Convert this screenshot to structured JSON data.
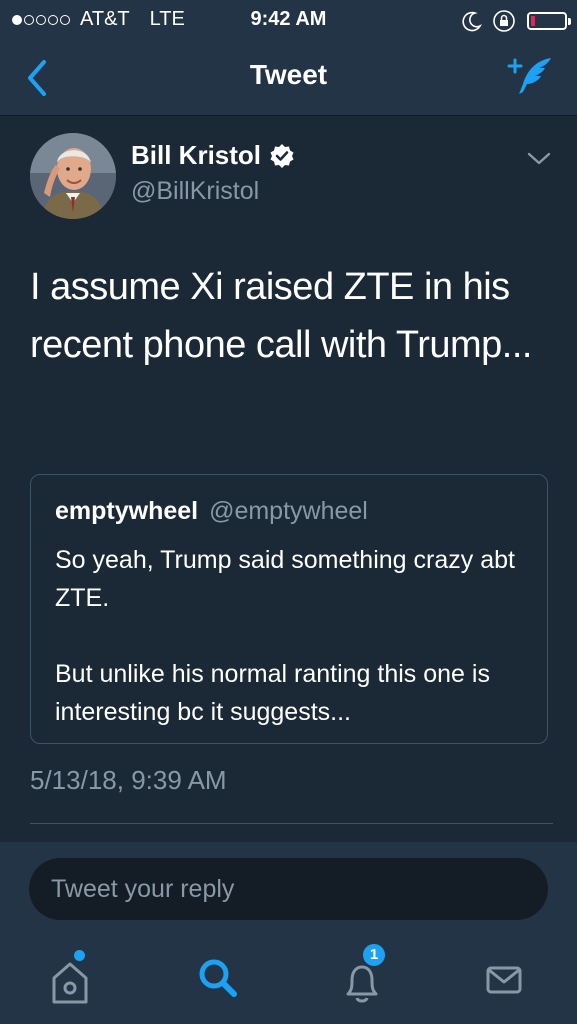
{
  "status_bar": {
    "carrier": "AT&T",
    "network": "LTE",
    "time": "9:42 AM"
  },
  "nav": {
    "title": "Tweet"
  },
  "tweet": {
    "author_name": "Bill Kristol",
    "author_handle": "@BillKristol",
    "text": "I assume Xi raised ZTE in his recent phone call with Trump...",
    "timestamp": "5/13/18, 9:39 AM",
    "quoted": {
      "author_name": "emptywheel",
      "author_handle": "@emptywheel",
      "text": "So yeah, Trump said something crazy abt ZTE.\n\nBut unlike his normal ranting this one is interesting bc it suggests..."
    }
  },
  "reply": {
    "placeholder": "Tweet your reply"
  },
  "tabs": {
    "notifications_count": "1"
  },
  "colors": {
    "background": "#1b2836",
    "bar": "#243447",
    "accent": "#1da1f2",
    "secondary_text": "#8899a6"
  }
}
